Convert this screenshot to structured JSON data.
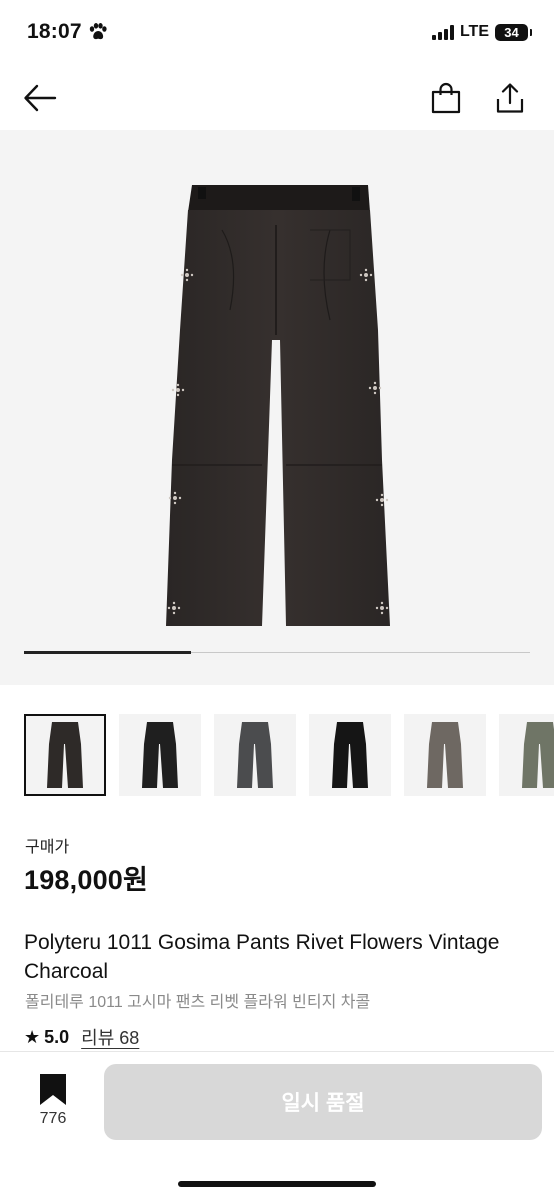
{
  "status_bar": {
    "time": "18:07",
    "network": "LTE",
    "battery": "34",
    "paw_icon": "paw-icon"
  },
  "nav": {
    "back_icon": "arrow-left-icon",
    "bag_icon": "shopping-bag-icon",
    "share_icon": "share-icon"
  },
  "gallery": {
    "image_alt": "Charcoal pants rear view",
    "progress": 0.33,
    "thumbnails": [
      {
        "color": "#2e2a28",
        "active": true
      },
      {
        "color": "#1f1f1f",
        "active": false
      },
      {
        "color": "#4b4c4e",
        "active": false
      },
      {
        "color": "#151515",
        "active": false
      },
      {
        "color": "#6e6862",
        "active": false
      },
      {
        "color": "#6f7566",
        "active": false
      }
    ]
  },
  "product": {
    "price_label": "구매가",
    "price": "198,000원",
    "title_en": "Polyteru 1011 Gosima Pants Rivet Flowers Vintage Charcoal",
    "title_ko": "폴리테루 1011 고시마 팬츠 리벳 플라워 빈티지 차콜",
    "rating_star": "★",
    "rating": "5.0",
    "review_link": "리뷰 68"
  },
  "bottom_bar": {
    "bookmark_icon": "bookmark-icon",
    "bookmark_count": "776",
    "cta_label": "일시 품절"
  }
}
